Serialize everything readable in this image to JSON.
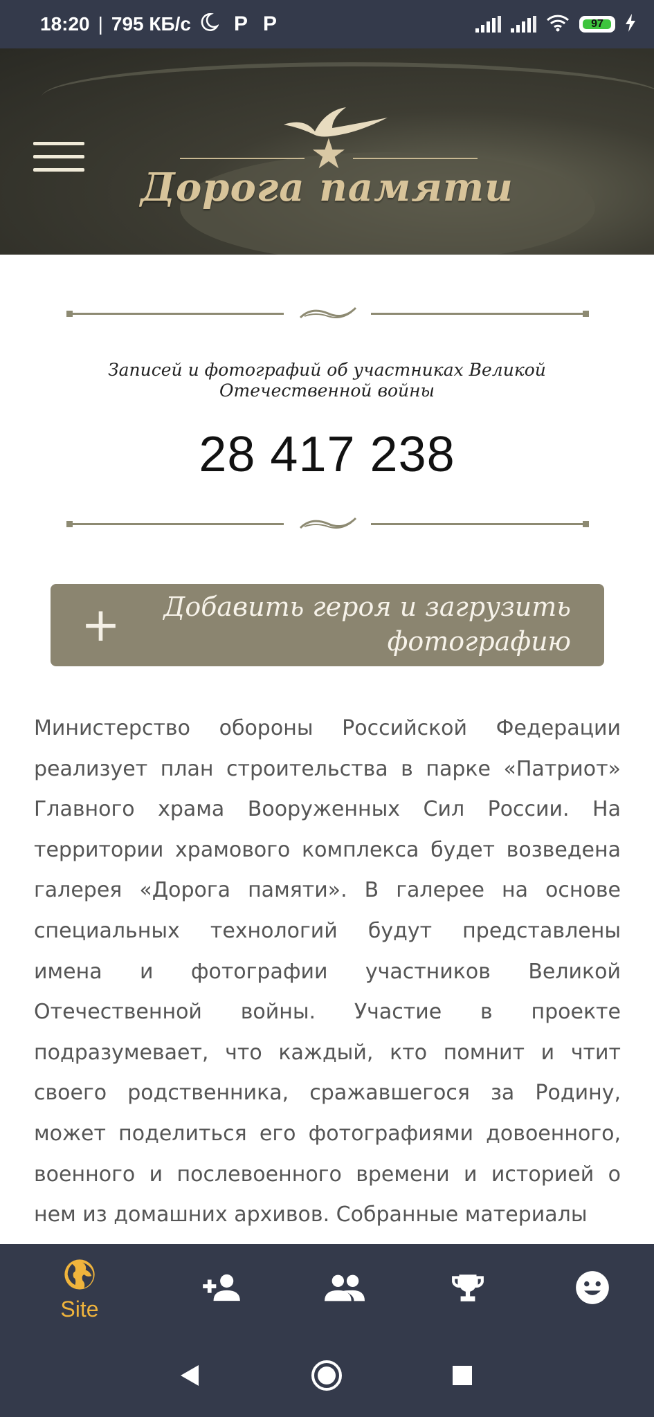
{
  "status_bar": {
    "time": "18:20",
    "separator": "|",
    "net_speed": "795 КБ/с",
    "moon_icon": "moon-icon",
    "app_icons": [
      "P",
      "P"
    ],
    "battery_level": "97",
    "battery_fraction": 0.97,
    "battery_color": "#3ec43e"
  },
  "banner": {
    "logo_text": "Дорога памяти",
    "menu_icon": "hamburger-menu-icon"
  },
  "counter": {
    "caption": "Записей и фотографий об участниках Великой Отечественной войны",
    "value": "28 417 238"
  },
  "add_hero_button": {
    "icon": "plus-icon",
    "label": "Добавить героя и загрузить фотографию",
    "background": "#8b8570"
  },
  "article": {
    "text": "Министерство обороны Российской Федерации реализует план строительства в парке «Патриот» Главного храма Вооруженных Сил России. На территории храмового комплекса будет возведена галерея «Дорога памяти». В галерее на основе специальных технологий будут представлены имена и фотографии участников Великой Отечественной войны. Участие в проекте подразумевает, что каждый, кто помнит и чтит своего родственника, сражавшегося за Родину, может поделиться его фотографиями довоенного, военного и послевоенного времени и историей о нем из домашних архивов. Собранные материалы"
  },
  "bottom_nav": {
    "active_color": "#f0b43c",
    "inactive_color": "#ffffff",
    "items": [
      {
        "icon": "globe-icon",
        "label": "Site",
        "active": true
      },
      {
        "icon": "add-person-icon",
        "label": "",
        "active": false
      },
      {
        "icon": "people-icon",
        "label": "",
        "active": false
      },
      {
        "icon": "trophy-icon",
        "label": "",
        "active": false
      },
      {
        "icon": "smiley-icon",
        "label": "",
        "active": false
      }
    ]
  },
  "system_nav": {
    "back": "back-icon",
    "home": "home-icon",
    "recents": "recents-icon"
  }
}
